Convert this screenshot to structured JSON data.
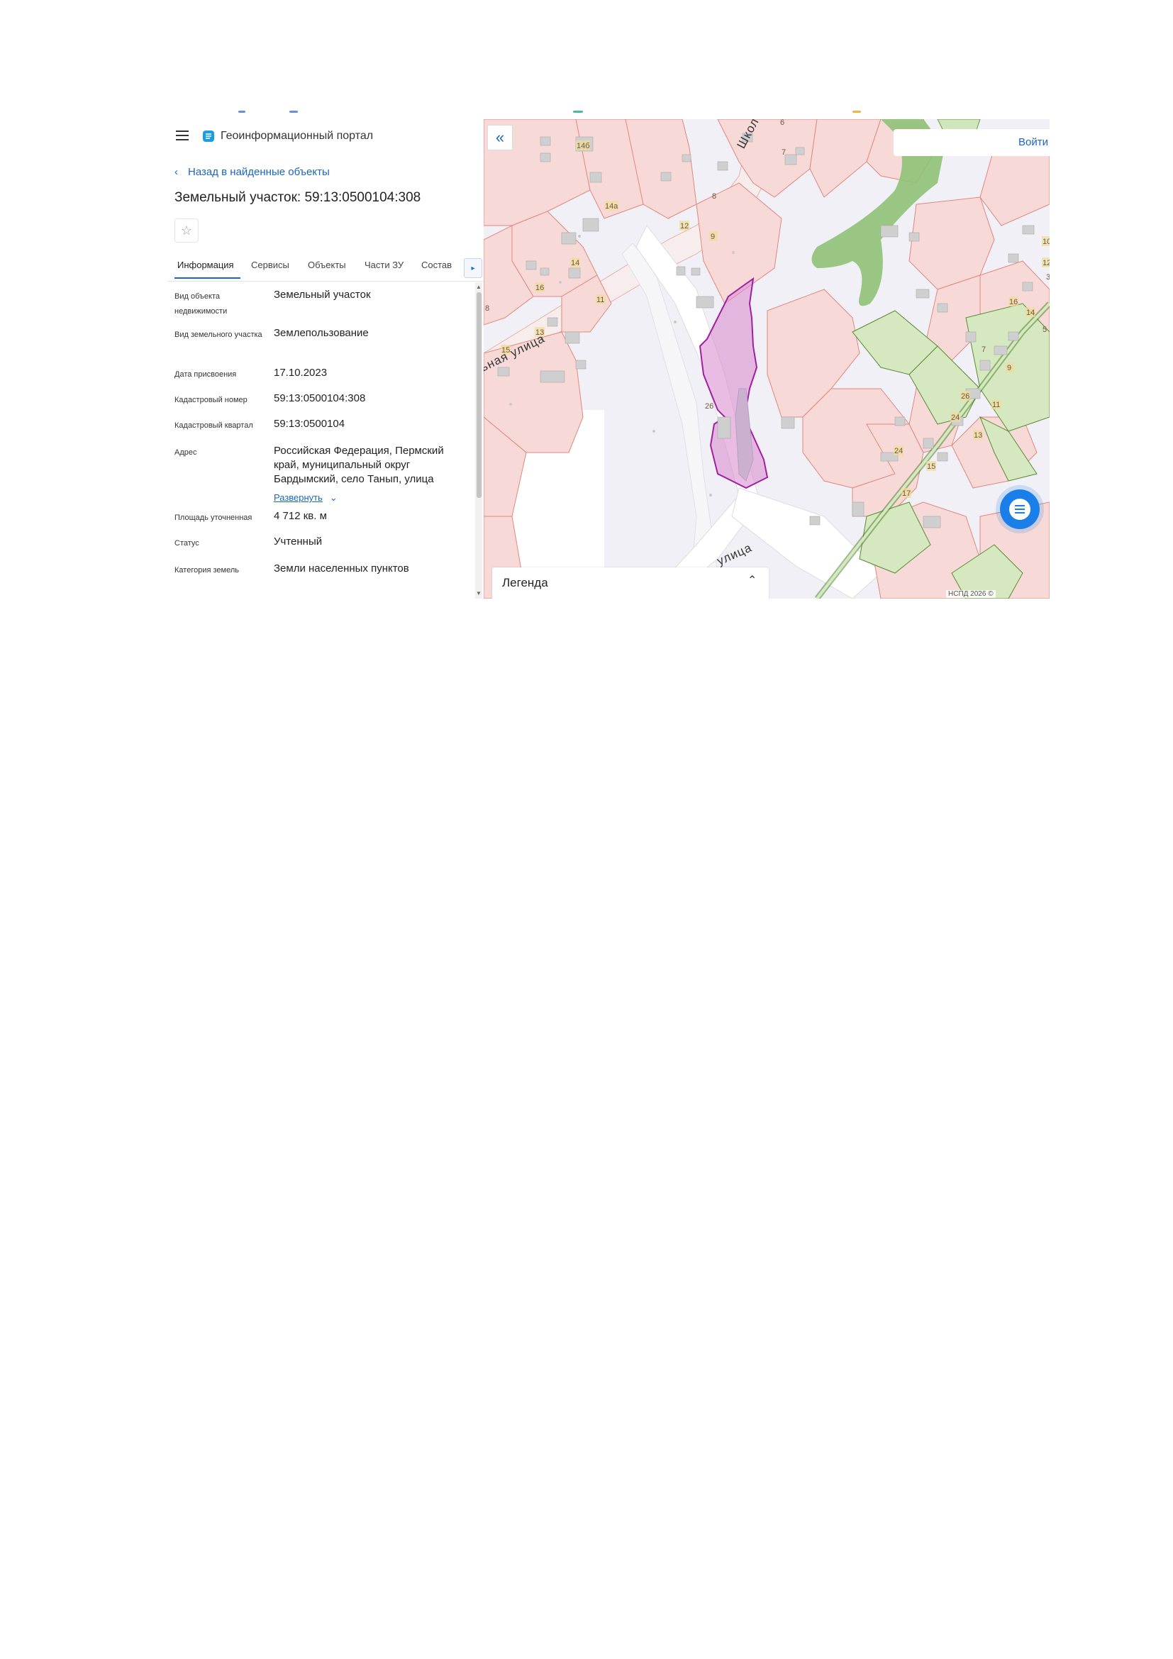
{
  "header": {
    "portal_name": "Геоинформационный портал"
  },
  "nav": {
    "back_label": "Назад в найденные объекты"
  },
  "object": {
    "title": "Земельный участок: 59:13:0500104:308"
  },
  "tabs": [
    {
      "label": "Информация",
      "active": true
    },
    {
      "label": "Сервисы"
    },
    {
      "label": "Объекты"
    },
    {
      "label": "Части ЗУ"
    },
    {
      "label": "Состав"
    }
  ],
  "properties": [
    {
      "label": "Вид объекта недвижимости",
      "value": "Земельный участок"
    },
    {
      "label": "Вид земельного участка",
      "value": "Землепользование"
    },
    {
      "label": "Дата присвоения",
      "value": "17.10.2023"
    },
    {
      "label": "Кадастровый номер",
      "value": "59:13:0500104:308"
    },
    {
      "label": "Кадастровый квартал",
      "value": "59:13:0500104"
    },
    {
      "label": "Адрес",
      "value": "Российская Федерация, Пермский край, муниципальный округ Бардымский, село Танып, улица"
    },
    {
      "label": "Площадь уточненная",
      "value": "4 712 кв. м"
    },
    {
      "label": "Статус",
      "value": "Учтенный"
    },
    {
      "label": "Категория земель",
      "value": "Земли населенных пунктов"
    }
  ],
  "address_expand_label": "Развернуть",
  "map": {
    "login_label": "Войти",
    "legend_label": "Легенда",
    "copyright": "НСПД 2026 ©",
    "streets": [
      "ьная улица",
      "Школ",
      "улица"
    ],
    "house_numbers": [
      "14б",
      "14а",
      "14",
      "16",
      "11",
      "13",
      "15",
      "8",
      "12",
      "9",
      "8",
      "7",
      "6",
      "26",
      "16",
      "12",
      "14",
      "10",
      "5",
      "7",
      "9",
      "11",
      "13",
      "15",
      "17",
      "24",
      "24",
      "26",
      "3"
    ],
    "colors": {
      "selected_parcel": "#d98fd0",
      "selected_border": "#a020a0",
      "parcel_fill": "#f7d9d7",
      "parcel_border": "#e2877e",
      "green_zone": "#8fc277",
      "green_parcel": "#d6e8c0",
      "accent": "#1a66c4"
    }
  }
}
